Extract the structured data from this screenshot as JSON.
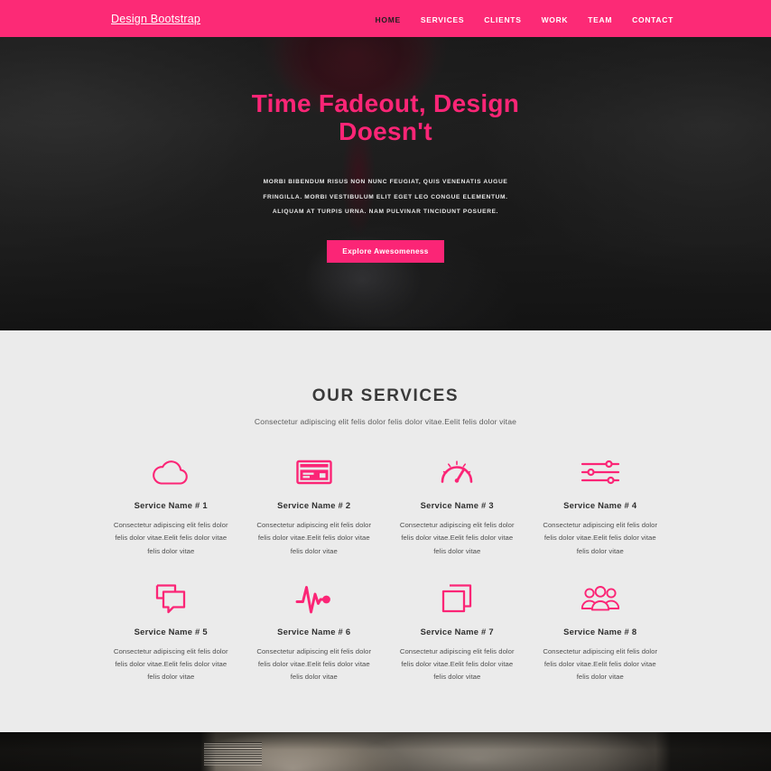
{
  "theme": {
    "pink": "#fc2a76",
    "pink_icon": "#fb2576",
    "dark": "#231f20",
    "services_bg": "#ebebeb"
  },
  "navbar": {
    "brand": "Design  Bootstrap",
    "links": [
      {
        "label": "HOME",
        "active": true
      },
      {
        "label": "SERVICES",
        "active": false
      },
      {
        "label": "CLIENTS",
        "active": false
      },
      {
        "label": "WORK",
        "active": false
      },
      {
        "label": "TEAM",
        "active": false
      },
      {
        "label": "CONTACT",
        "active": false
      }
    ]
  },
  "hero": {
    "title": "Time Fadeout, Design Doesn't",
    "subtitle": "Morbi bibendum risus non nunc feugiat, quis venenatis augue fringilla. Morbi vestibulum elit eget leo congue elementum. Aliquam at turpis urna. Nam pulvinar tincidunt posuere.",
    "button_label": "Explore Awesomeness"
  },
  "services": {
    "title": "OUR SERVICES",
    "subtitle": "Consectetur adipiscing elit felis dolor felis dolor vitae.Eelit felis dolor vitae",
    "description": "Consectetur adipiscing elit felis dolor felis dolor vitae.Eelit felis dolor vitae felis dolor vitae",
    "items": [
      {
        "name": "Service Name # 1",
        "icon": "cloud-icon",
        "description": "Consectetur adipiscing elit felis dolor felis dolor vitae.Eelit felis dolor vitae felis dolor vitae"
      },
      {
        "name": "Service Name # 2",
        "icon": "credit-card-icon",
        "description": "Consectetur adipiscing elit felis dolor felis dolor vitae.Eelit felis dolor vitae felis dolor vitae"
      },
      {
        "name": "Service Name # 3",
        "icon": "speedometer-icon",
        "description": "Consectetur adipiscing elit felis dolor felis dolor vitae.Eelit felis dolor vitae felis dolor vitae"
      },
      {
        "name": "Service Name # 4",
        "icon": "sliders-icon",
        "description": "Consectetur adipiscing elit felis dolor felis dolor vitae.Eelit felis dolor vitae felis dolor vitae"
      },
      {
        "name": "Service Name # 5",
        "icon": "chat-bubbles-icon",
        "description": "Consectetur adipiscing elit felis dolor felis dolor vitae.Eelit felis dolor vitae felis dolor vitae"
      },
      {
        "name": "Service Name # 6",
        "icon": "pulse-icon",
        "description": "Consectetur adipiscing elit felis dolor felis dolor vitae.Eelit felis dolor vitae felis dolor vitae"
      },
      {
        "name": "Service Name # 7",
        "icon": "layers-icon",
        "description": "Consectetur adipiscing elit felis dolor felis dolor vitae.Eelit felis dolor vitae felis dolor vitae"
      },
      {
        "name": "Service Name # 8",
        "icon": "team-group-icon",
        "description": "Consectetur adipiscing elit felis dolor felis dolor vitae.Eelit felis dolor vitae felis dolor vitae"
      }
    ]
  }
}
